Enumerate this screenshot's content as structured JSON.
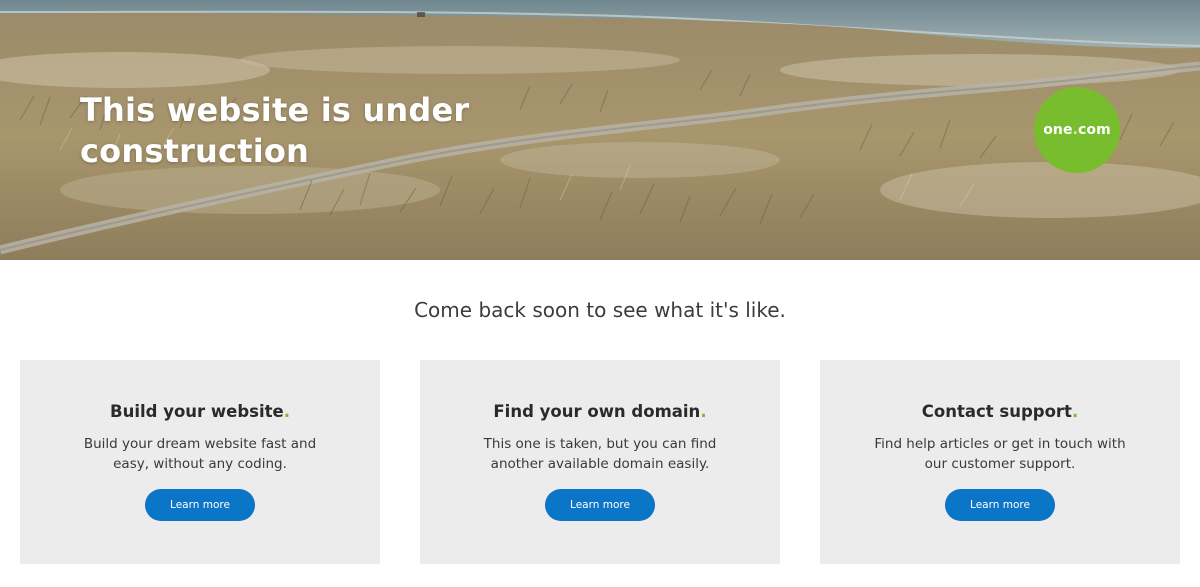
{
  "hero": {
    "title": "This website is under construction",
    "brand": {
      "name": "one",
      "separator": ".",
      "tld": "com",
      "color": "#78bd2d"
    }
  },
  "tagline": "Come back soon to see what it's like.",
  "cards": [
    {
      "title": "Build your website",
      "accent": ".",
      "description": "Build your dream website fast and easy, without any coding.",
      "button_label": "Learn more"
    },
    {
      "title": "Find your own domain",
      "accent": ".",
      "description": "This one is taken, but you can find another available domain easily.",
      "button_label": "Learn more"
    },
    {
      "title": "Contact support",
      "accent": ".",
      "description": "Find help articles or get in touch with our customer support.",
      "button_label": "Learn more"
    }
  ],
  "colors": {
    "accent_green": "#78bd2d",
    "button_blue": "#0b75c8",
    "card_background": "#ececec"
  }
}
